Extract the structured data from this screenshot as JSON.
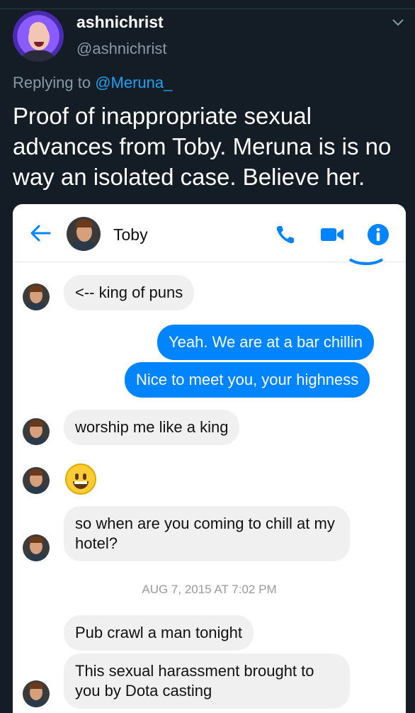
{
  "tweet": {
    "username": "ashnichrist",
    "handle": "@ashnichrist",
    "replying_prefix": "Replying to",
    "replying_to": "@Meruna_",
    "text": "Proof of inappropriate sexual advances from Toby. Meruna is is no way an isolated case. Believe her."
  },
  "screenshot": {
    "contact_name": "Toby",
    "messages": [
      {
        "side": "in",
        "text": "<-- king of puns"
      },
      {
        "side": "out",
        "text": "Yeah. We are at a bar chillin"
      },
      {
        "side": "out",
        "text": "Nice to meet you, your highness"
      },
      {
        "side": "in",
        "text": "worship me like a king"
      },
      {
        "side": "in",
        "text": "so when are you coming to chill at my hotel?"
      },
      {
        "side": "in",
        "text": "Pub crawl a man tonight"
      },
      {
        "side": "in",
        "text": "This sexual harassment brought to you by Dota casting"
      }
    ],
    "timestamp": "AUG 7, 2015 AT 7:02 PM"
  },
  "colors": {
    "background": "#141d26",
    "link": "#1da1f2",
    "secondary_text": "#8899a6",
    "messenger_blue": "#0084ff",
    "incoming_bubble": "#f1f0f0"
  },
  "icons": [
    "chevron-down-icon",
    "back-arrow-icon",
    "phone-icon",
    "video-camera-icon",
    "info-icon",
    "grinning-emoji-icon"
  ]
}
